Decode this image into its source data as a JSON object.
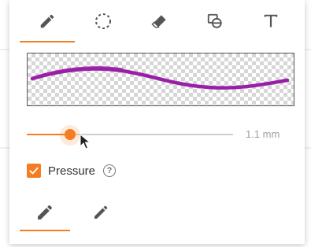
{
  "colors": {
    "accent": "#f57c20",
    "stroke": "#9a1fa8",
    "icon": "#555555"
  },
  "tool_tabs": [
    {
      "icon": "pencil-icon",
      "selected": true
    },
    {
      "icon": "lasso-select-icon",
      "selected": false
    },
    {
      "icon": "eraser-icon",
      "selected": false
    },
    {
      "icon": "shapes-icon",
      "selected": false
    },
    {
      "icon": "text-icon",
      "selected": false
    }
  ],
  "stroke_size": {
    "value_fraction": 0.21,
    "readout": "1.1 mm"
  },
  "pressure": {
    "label": "Pressure",
    "checked": true,
    "help_glyph": "?"
  },
  "pen_types": [
    {
      "icon": "pen-icon",
      "selected": true
    },
    {
      "icon": "highlighter-icon",
      "selected": false
    }
  ]
}
